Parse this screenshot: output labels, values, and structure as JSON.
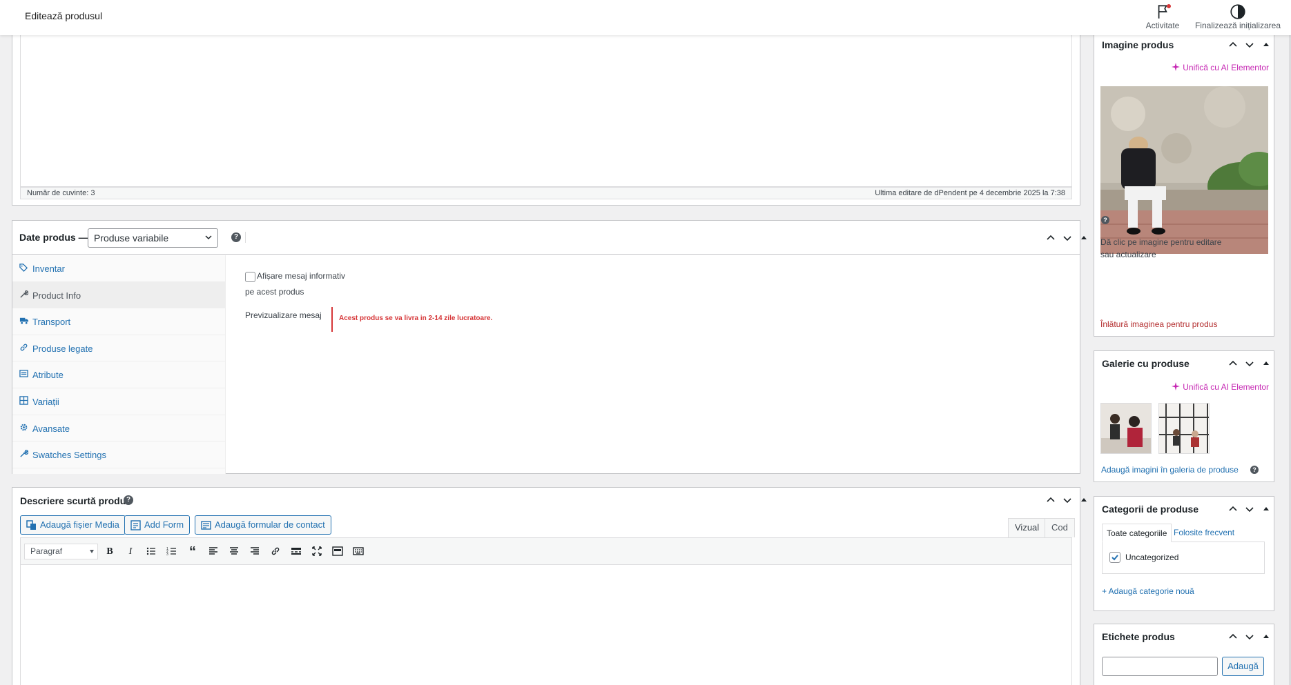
{
  "topbar": {
    "title": "Editează produsul",
    "activity_label": "Activitate",
    "finish_label": "Finalizează inițializarea"
  },
  "editor": {
    "word_count": "Număr de cuvinte: 3",
    "last_edit": "Ultima editare de dPendent pe 4 decembrie 2025 la 7:38"
  },
  "product_data": {
    "label": "Date produs —",
    "type_selected": "Produse variabile",
    "tabs": [
      {
        "label": "Inventar",
        "icon": "tag-icon"
      },
      {
        "label": "Product Info",
        "icon": "wrench-icon"
      },
      {
        "label": "Transport",
        "icon": "truck-icon"
      },
      {
        "label": "Produse legate",
        "icon": "link-icon"
      },
      {
        "label": "Atribute",
        "icon": "list-icon"
      },
      {
        "label": "Variații",
        "icon": "grid-icon"
      },
      {
        "label": "Avansate",
        "icon": "gear-icon"
      },
      {
        "label": "Swatches Settings",
        "icon": "wrench-icon"
      }
    ],
    "active_tab": "Product Info",
    "panel": {
      "checkbox_label": "Afișare mesaj informativ",
      "checkbox_label_2": "pe acest produs",
      "preview_label": "Previzualizare mesaj",
      "preview_message": "Acest produs se va livra in 2-14 zile lucratoare."
    }
  },
  "short_desc": {
    "title": "Descriere scurtă produs",
    "buttons": [
      "Adaugă fișier Media",
      "Add Form",
      "Adaugă formular de contact"
    ],
    "tabs": [
      "Vizual",
      "Cod"
    ],
    "format": "Paragraf",
    "toolbar_icons": [
      "bold-icon",
      "italic-icon",
      "bullet-list-icon",
      "numbered-list-icon",
      "blockquote-icon",
      "align-left-icon",
      "align-center-icon",
      "align-right-icon",
      "link-icon",
      "read-more-icon",
      "fullscreen-icon",
      "toolbar-toggle-icon",
      "keyboard-icon"
    ]
  },
  "sidebar": {
    "image": {
      "title": "Imagine produs",
      "ai_link": "Unifică cu AI Elementor",
      "hint_1": "Dă clic pe imagine pentru editare",
      "hint_2": "sau actualizare",
      "remove": "Înlătură imaginea pentru produs"
    },
    "gallery": {
      "title": "Galerie cu produse",
      "ai_link": "Unifică cu AI Elementor",
      "add_link": "Adaugă imagini în galeria de produse"
    },
    "categories": {
      "title": "Categorii de produse",
      "tab_all": "Toate categoriile",
      "tab_frequent": "Folosite frecvent",
      "items": [
        {
          "label": "Uncategorized",
          "checked": true
        }
      ],
      "add_new": "+ Adaugă categorie nouă"
    },
    "tags": {
      "title": "Etichete produs",
      "add_button": "Adaugă"
    }
  },
  "colors": {
    "link": "#2271b1",
    "danger": "#d63638",
    "ai": "#c628b3"
  }
}
